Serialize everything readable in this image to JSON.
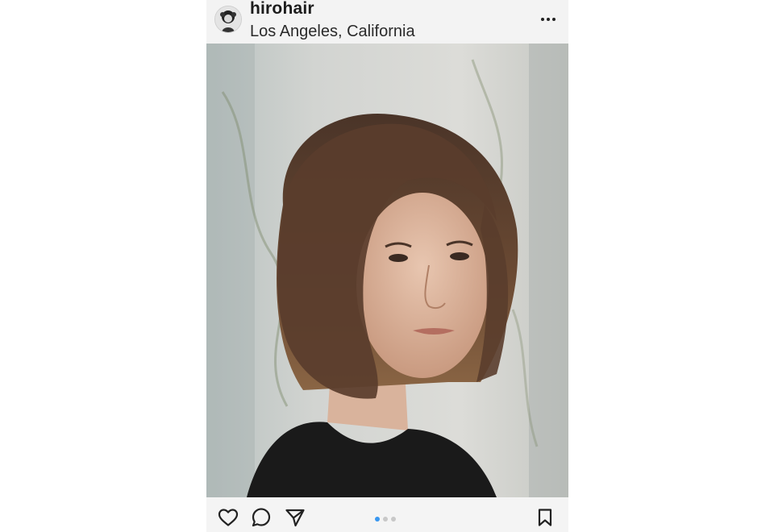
{
  "post": {
    "username": "hirohair",
    "location": "Los Angeles, California"
  },
  "icons": {
    "avatar": "profile-avatar",
    "more": "more-options-icon",
    "tag": "user-tag-icon",
    "like": "heart-icon",
    "comment": "comment-bubble-icon",
    "share": "paper-plane-icon",
    "save": "bookmark-icon"
  },
  "carousel": {
    "total": 3,
    "active_index": 0
  },
  "colors": {
    "accent": "#3897f0",
    "text": "#1c1c1c"
  }
}
